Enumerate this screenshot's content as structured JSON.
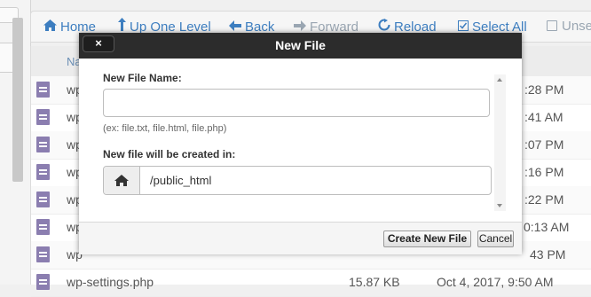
{
  "toolbar": {
    "home": "Home",
    "up_one_level": "Up One Level",
    "back": "Back",
    "forward": "Forward",
    "reload": "Reload",
    "select_all": "Select All",
    "unselect_all": "Unse"
  },
  "table": {
    "name_header": "Na",
    "rows": [
      {
        "name": "wp",
        "size": "",
        "date": ":28 PM"
      },
      {
        "name": "wp",
        "size": "",
        "date": ":41 AM"
      },
      {
        "name": "wp",
        "size": "",
        "date": ":07 PM"
      },
      {
        "name": "wp",
        "size": "",
        "date": ":16 PM"
      },
      {
        "name": "wp",
        "size": "",
        "date": ":22 PM"
      },
      {
        "name": "wp",
        "size": "",
        "date": "0:13 AM"
      },
      {
        "name": "wp",
        "size": "",
        "date": "43 PM"
      },
      {
        "name": "wp-settings.php",
        "size": "15.87 KB",
        "date": "Oct 4, 2017, 9:50 AM"
      }
    ]
  },
  "dialog": {
    "title": "New File",
    "close_label": "×",
    "file_name_label": "New File Name:",
    "file_name_value": "",
    "file_name_hint": "(ex: file.txt, file.html, file.php)",
    "location_label": "New file will be created in:",
    "location_value": "/public_html",
    "create_button": "Create New File",
    "cancel_button": "Cancel"
  },
  "icons": {
    "home": "home-icon",
    "up": "arrow-up-icon",
    "back": "arrow-left-icon",
    "forward": "arrow-right-icon",
    "reload": "reload-icon",
    "select_all": "checkbox-checked-icon",
    "unselect_all": "checkbox-empty-icon",
    "file": "file-text-icon",
    "path": "home-icon"
  },
  "colors": {
    "link": "#3d7ec0",
    "disabled": "#9aa6b2",
    "header_bg": "#2c2c2c",
    "file_icon": "#8b7eb0"
  }
}
